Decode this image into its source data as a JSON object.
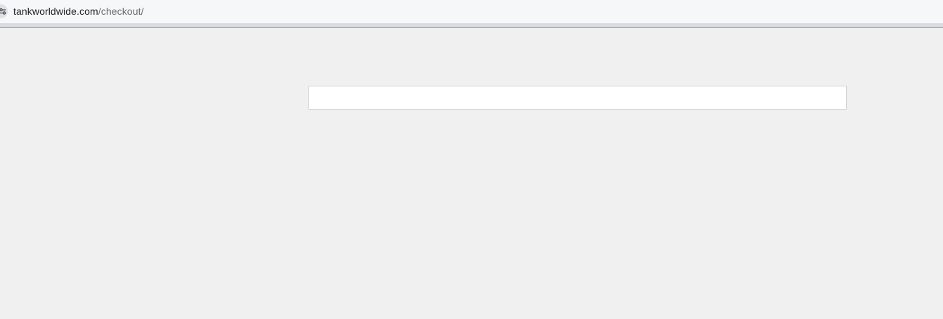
{
  "browser": {
    "url_host": "tankworldwide.com",
    "url_path": "/checkout/",
    "site_info_icon": "tune-icon"
  },
  "page": {
    "background_color": "#f0f0f0",
    "checkout_box_value": ""
  }
}
